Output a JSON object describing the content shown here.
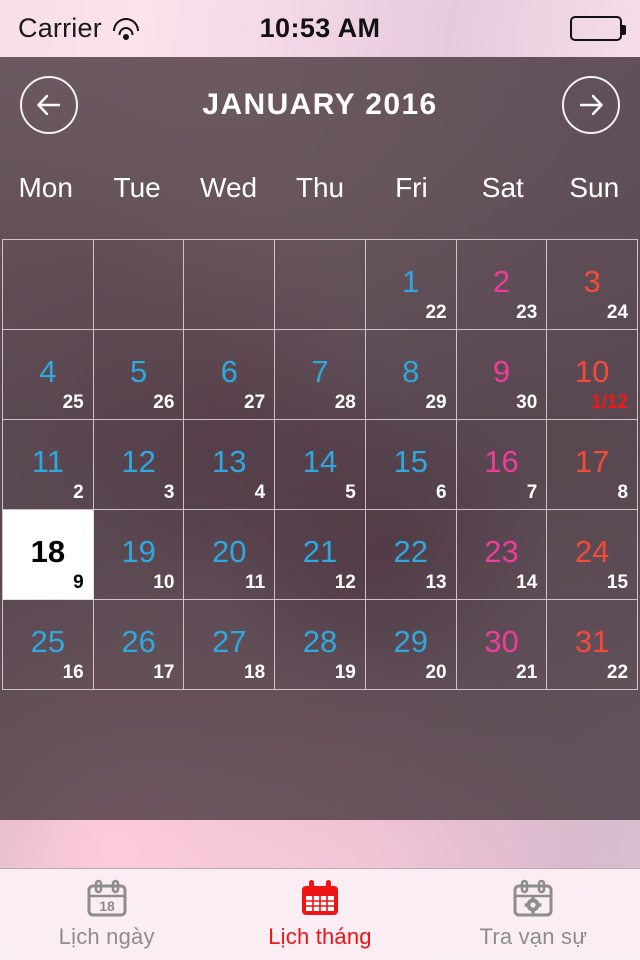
{
  "status_bar": {
    "carrier": "Carrier",
    "wifi_icon": "wifi-icon",
    "time": "10:53 AM",
    "battery_icon": "battery-full-icon"
  },
  "header": {
    "prev_icon": "arrow-left-icon",
    "next_icon": "arrow-right-icon",
    "title": "JANUARY 2016"
  },
  "weekdays": [
    "Mon",
    "Tue",
    "Wed",
    "Thu",
    "Fri",
    "Sat",
    "Sun"
  ],
  "colors": {
    "weekday_blue": "#2FA8DE",
    "saturday_pink": "#EE3D9B",
    "sunday_red": "#F24B3A",
    "today_bg": "#FFFFFF",
    "today_text": "#000000",
    "lunar_white": "#FFFFFF",
    "lunar_new_month_red": "#F01818",
    "active_tab_red": "#EF1414",
    "inactive_tab_gray": "#8D8D8D"
  },
  "calendar": {
    "weeks": [
      [
        {
          "solar": "",
          "lunar": "",
          "empty": true
        },
        {
          "solar": "",
          "lunar": "",
          "empty": true
        },
        {
          "solar": "",
          "lunar": "",
          "empty": true
        },
        {
          "solar": "",
          "lunar": "",
          "empty": true
        },
        {
          "solar": "1",
          "lunar": "22",
          "color": "#2FA8DE"
        },
        {
          "solar": "2",
          "lunar": "23",
          "color": "#EE3D9B"
        },
        {
          "solar": "3",
          "lunar": "24",
          "color": "#F24B3A"
        }
      ],
      [
        {
          "solar": "4",
          "lunar": "25",
          "color": "#2FA8DE"
        },
        {
          "solar": "5",
          "lunar": "26",
          "color": "#2FA8DE"
        },
        {
          "solar": "6",
          "lunar": "27",
          "color": "#2FA8DE"
        },
        {
          "solar": "7",
          "lunar": "28",
          "color": "#2FA8DE"
        },
        {
          "solar": "8",
          "lunar": "29",
          "color": "#2FA8DE"
        },
        {
          "solar": "9",
          "lunar": "30",
          "color": "#EE3D9B"
        },
        {
          "solar": "10",
          "lunar": "1/12",
          "color": "#F24B3A",
          "lunar_new_month": true
        }
      ],
      [
        {
          "solar": "11",
          "lunar": "2",
          "color": "#2FA8DE"
        },
        {
          "solar": "12",
          "lunar": "3",
          "color": "#2FA8DE"
        },
        {
          "solar": "13",
          "lunar": "4",
          "color": "#2FA8DE"
        },
        {
          "solar": "14",
          "lunar": "5",
          "color": "#2FA8DE"
        },
        {
          "solar": "15",
          "lunar": "6",
          "color": "#2FA8DE"
        },
        {
          "solar": "16",
          "lunar": "7",
          "color": "#EE3D9B"
        },
        {
          "solar": "17",
          "lunar": "8",
          "color": "#F24B3A"
        }
      ],
      [
        {
          "solar": "18",
          "lunar": "9",
          "color": "#000000",
          "today": true
        },
        {
          "solar": "19",
          "lunar": "10",
          "color": "#2FA8DE"
        },
        {
          "solar": "20",
          "lunar": "11",
          "color": "#2FA8DE"
        },
        {
          "solar": "21",
          "lunar": "12",
          "color": "#2FA8DE"
        },
        {
          "solar": "22",
          "lunar": "13",
          "color": "#2FA8DE"
        },
        {
          "solar": "23",
          "lunar": "14",
          "color": "#EE3D9B"
        },
        {
          "solar": "24",
          "lunar": "15",
          "color": "#F24B3A"
        }
      ],
      [
        {
          "solar": "25",
          "lunar": "16",
          "color": "#2FA8DE"
        },
        {
          "solar": "26",
          "lunar": "17",
          "color": "#2FA8DE"
        },
        {
          "solar": "27",
          "lunar": "18",
          "color": "#2FA8DE"
        },
        {
          "solar": "28",
          "lunar": "19",
          "color": "#2FA8DE"
        },
        {
          "solar": "29",
          "lunar": "20",
          "color": "#2FA8DE"
        },
        {
          "solar": "30",
          "lunar": "21",
          "color": "#EE3D9B"
        },
        {
          "solar": "31",
          "lunar": "22",
          "color": "#F24B3A"
        }
      ]
    ]
  },
  "tabbar": {
    "tabs": [
      {
        "label": "Lịch ngày",
        "icon": "calendar-day-icon",
        "active": false
      },
      {
        "label": "Lịch tháng",
        "icon": "calendar-month-icon",
        "active": true
      },
      {
        "label": "Tra vạn sự",
        "icon": "calendar-gear-icon",
        "active": false
      }
    ]
  }
}
